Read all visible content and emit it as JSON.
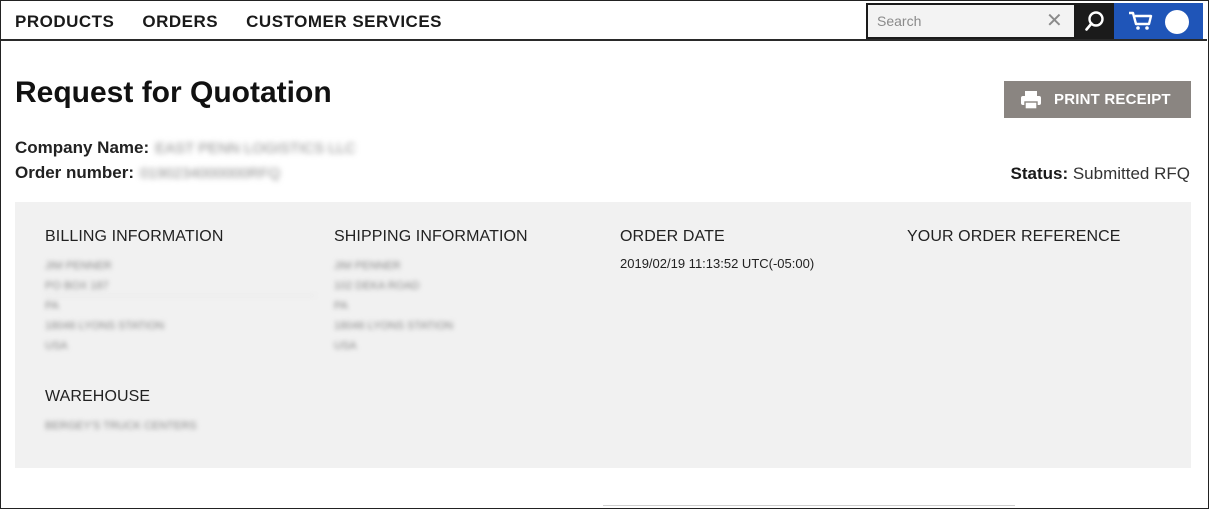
{
  "nav": {
    "items": [
      "PRODUCTS",
      "ORDERS",
      "CUSTOMER SERVICES"
    ]
  },
  "search": {
    "placeholder": "Search",
    "value": ""
  },
  "icons": {
    "clear": "close-icon",
    "search": "search-icon",
    "cart": "cart-icon",
    "avatar": "user-avatar",
    "print": "printer-icon"
  },
  "colors": {
    "cart_bg": "#1f55b8",
    "print_bg": "#8a8581",
    "panel_bg": "#f1f1f1"
  },
  "page": {
    "title": "Request for Quotation",
    "print_label": "PRINT RECEIPT",
    "company_label": "Company Name:",
    "company_value": "EAST PENN LOGISTICS LLC",
    "order_label": "Order number:",
    "order_value": "0190234000000RFQ",
    "status_label": "Status:",
    "status_value": "Submitted RFQ"
  },
  "panel": {
    "billing": {
      "heading": "BILLING INFORMATION",
      "lines": [
        "JIM PENNER",
        "PO BOX 187",
        "PA",
        "18046 LYONS STATION",
        "USA"
      ]
    },
    "shipping": {
      "heading": "SHIPPING INFORMATION",
      "lines": [
        "JIM PENNER",
        "102 DEKA ROAD",
        "PA",
        "18046 LYONS STATION",
        "USA"
      ]
    },
    "order_date": {
      "heading": "ORDER DATE",
      "value": "2019/02/19 11:13:52 UTC(-05:00)"
    },
    "reference": {
      "heading": "YOUR ORDER REFERENCE"
    },
    "warehouse": {
      "heading": "WAREHOUSE",
      "value": "BERGEY'S TRUCK CENTERS"
    }
  }
}
